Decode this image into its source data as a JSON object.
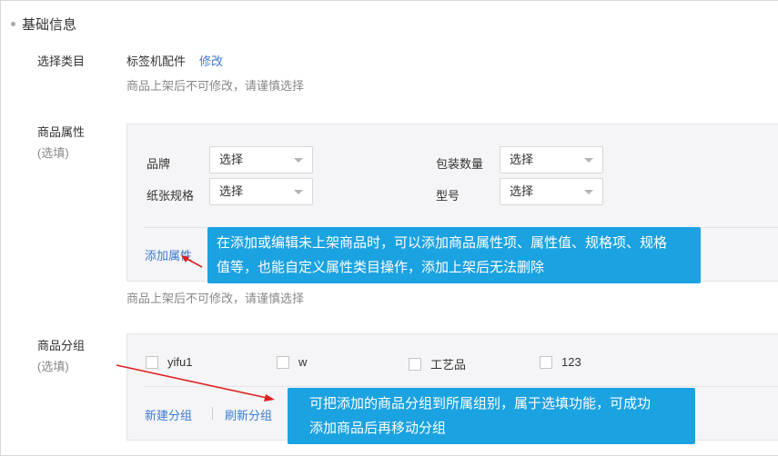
{
  "section": {
    "title": "基础信息"
  },
  "category": {
    "label": "选择类目",
    "value": "标签机配件",
    "edit_link": "修改",
    "hint": "商品上架后不可修改，请谨慎选择"
  },
  "attributes": {
    "label": "商品属性",
    "optional": "(选填)",
    "fields": [
      {
        "label": "品牌",
        "value": "选择"
      },
      {
        "label": "包装数量",
        "value": "选择"
      },
      {
        "label": "纸张规格",
        "value": "选择"
      },
      {
        "label": "型号",
        "value": "选择"
      }
    ],
    "add_link": "添加属性",
    "hint": "商品上架后不可修改，请谨慎选择",
    "tooltip_line1": "在添加或编辑未上架商品时，可以添加商品属性项、属性值、规格项、规格",
    "tooltip_line2": "值等，也能自定义属性类目操作，添加上架后无法删除"
  },
  "groups": {
    "label": "商品分组",
    "optional": "(选填)",
    "items": [
      {
        "label": "yifu1",
        "checked": false
      },
      {
        "label": "w",
        "checked": false
      },
      {
        "label": "工艺品",
        "checked": false
      },
      {
        "label": "123",
        "checked": false
      }
    ],
    "new_link": "新建分组",
    "refresh_link": "刷新分组",
    "tooltip_line1": "可把添加的商品分组到所属组别，属于选填功能，可成功",
    "tooltip_line2": "添加商品后再移动分组"
  },
  "colors": {
    "accent": "#3a7bd5",
    "tooltip": "#1ba2e1",
    "arrow": "#e02020"
  },
  "icons": [
    "bullet-dot-icon",
    "caret-down-icon",
    "checkbox-icon",
    "red-arrow-icon"
  ]
}
